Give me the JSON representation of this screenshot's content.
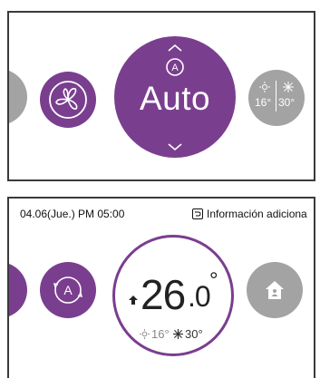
{
  "panel1": {
    "mode_label": "Auto",
    "heat_setpoint": "16°",
    "cool_setpoint": "30°"
  },
  "panel2": {
    "datetime": "04.06(Jue.)  PM 05:00",
    "info_link": "Información adiciona",
    "temperature": "26",
    "temperature_decimal": ".0",
    "temperature_unit": "°",
    "heat_setpoint": "16°",
    "cool_setpoint": "30°"
  },
  "colors": {
    "accent_purple": "#7a3e8f",
    "inactive_grey": "#a3a3a3"
  },
  "icons": [
    "fan-icon",
    "auto-mode-icon",
    "chevron-up-icon",
    "chevron-down-icon",
    "sun-icon",
    "snowflake-icon",
    "home-icon",
    "info-icon",
    "arrow-up-icon"
  ]
}
